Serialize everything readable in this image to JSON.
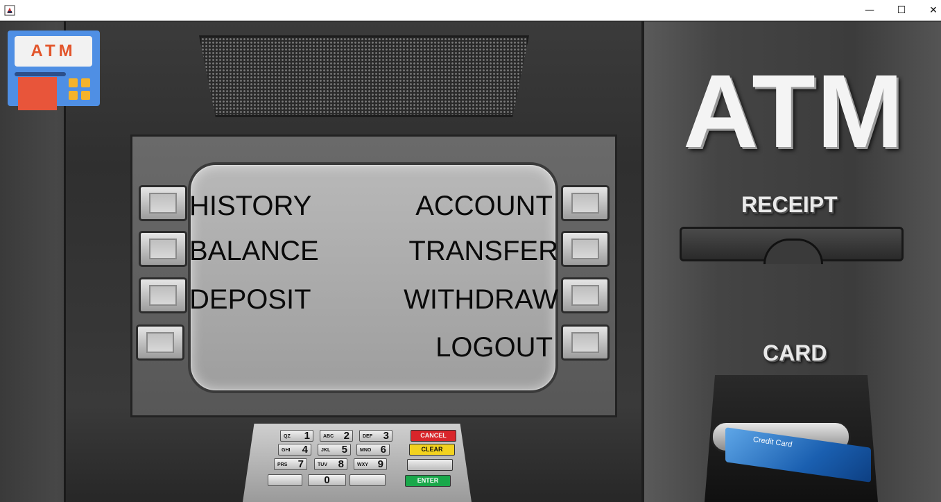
{
  "window": {
    "minimize_glyph": "—",
    "maximize_glyph": "☐",
    "close_glyph": "✕"
  },
  "logo": {
    "text": "ATM"
  },
  "menu": {
    "left": [
      "HISTORY",
      "BALANCE",
      "DEPOSIT"
    ],
    "right": [
      "ACCOUNT",
      "TRANSFER",
      "WITHDRAW",
      "LOGOUT"
    ]
  },
  "brand": {
    "title": "ATM",
    "receipt_label": "RECEIPT",
    "card_label": "CARD"
  },
  "keypad": {
    "rows": [
      [
        {
          "sub": "QZ",
          "num": "1"
        },
        {
          "sub": "ABC",
          "num": "2"
        },
        {
          "sub": "DEF",
          "num": "3"
        }
      ],
      [
        {
          "sub": "GHI",
          "num": "4"
        },
        {
          "sub": "JKL",
          "num": "5"
        },
        {
          "sub": "MNO",
          "num": "6"
        }
      ],
      [
        {
          "sub": "PRS",
          "num": "7"
        },
        {
          "sub": "TUV",
          "num": "8"
        },
        {
          "sub": "WXY",
          "num": "9"
        }
      ],
      [
        {
          "sub": "",
          "num": ""
        },
        {
          "sub": "",
          "num": "0"
        },
        {
          "sub": "",
          "num": ""
        }
      ]
    ],
    "cancel": "CANCEL",
    "clear": "CLEAR",
    "enter": "ENTER"
  },
  "card": {
    "text": "Credit Card"
  },
  "colors": {
    "cancel": "#d9252a",
    "clear": "#f2d21f",
    "enter": "#19a84a",
    "logo_bg": "#4f8fe4"
  }
}
